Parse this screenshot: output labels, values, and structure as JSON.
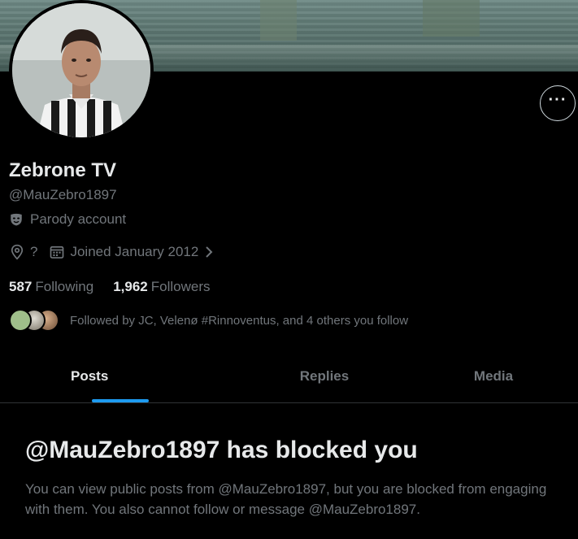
{
  "profile": {
    "display_name": "Zebrone TV",
    "handle": "@MauZebro1897",
    "parody_label": "Parody account",
    "location": "?",
    "joined": "Joined January 2012",
    "following_count": "587",
    "following_label": "Following",
    "followers_count": "1,962",
    "followers_label": "Followers",
    "followed_by": "Followed by JC, Velenø #Rinnoventus, and 4 others you follow"
  },
  "tabs": [
    {
      "label": "Posts",
      "active": true
    },
    {
      "label": "Replies",
      "active": false
    },
    {
      "label": "Media",
      "active": false
    }
  ],
  "blocked": {
    "title": "@MauZebro1897 has blocked you",
    "message": "You can view public posts from @MauZebro1897, but you are blocked from engaging with them. You also cannot follow or message @MauZebro1897."
  },
  "icons": {
    "more": "more-horizontal-icon",
    "parody": "mask-icon",
    "location": "location-pin-icon",
    "calendar": "calendar-icon",
    "chevron": "chevron-right-icon"
  },
  "colors": {
    "background": "#000000",
    "primary_text": "#e7e9ea",
    "secondary_text": "#71767b",
    "accent": "#1d9bf0",
    "divider": "#2f3336"
  }
}
